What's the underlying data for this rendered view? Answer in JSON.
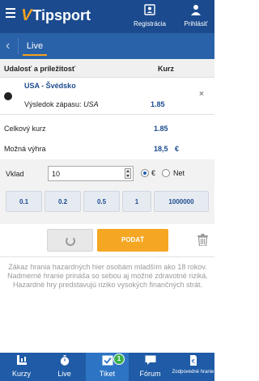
{
  "header": {
    "logo": "Tipsport",
    "registration": "Registrácia",
    "login": "Prihlásiť"
  },
  "subnav": {
    "back": "‹",
    "active_tab": "Live"
  },
  "table_header": {
    "left": "Udalosť a príležitosť",
    "right": "Kurz"
  },
  "bet": {
    "match": "USA - Švédsko",
    "market_label": "Výsledok zápasu:",
    "selection": "USA",
    "odd": "1.85",
    "remove": "×"
  },
  "summary": {
    "total_odds_label": "Celkový kurz",
    "total_odds": "1.85",
    "possible_win_label": "Možná výhra",
    "possible_win": "18,5 €"
  },
  "stake": {
    "label": "Vklad",
    "value": "10",
    "currency_option": "€",
    "net_option": "Net",
    "quick": [
      "0.1",
      "0.2",
      "0.5",
      "1",
      "1000000"
    ]
  },
  "actions": {
    "submit": "PODAŤ"
  },
  "disclaimer": [
    "Zákaz hrania hazardných hier osobám mladším ako 18 rokov.",
    "Nadmerné hranie prináša so sebou aj možné zdravotné riziká.",
    "Hazardné hry predstavujú riziko vysokých finančných strát."
  ],
  "bottom_nav": {
    "items": [
      "Kurzy",
      "Live",
      "Tiket",
      "Fórum",
      "Zodpovedné hranie"
    ],
    "ticket_badge": "1"
  },
  "colors": {
    "primary": "#1b4b8e",
    "accent": "#f5a623",
    "badge": "#3db04b"
  }
}
